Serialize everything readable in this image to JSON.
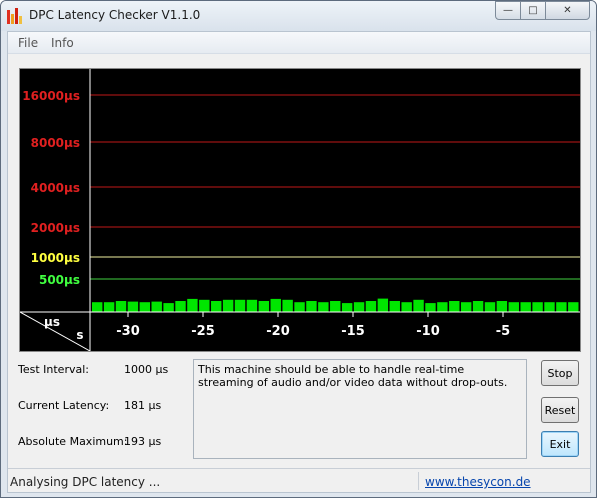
{
  "window": {
    "title": "DPC Latency Checker V1.1.0",
    "controls": {
      "minimize": "—",
      "maximize": "□",
      "close": "✕"
    }
  },
  "menu": {
    "items": [
      "File",
      "Info"
    ]
  },
  "chart_data": {
    "type": "bar",
    "y_labels": [
      "16000µs",
      "8000µs",
      "4000µs",
      "2000µs",
      "1000µs",
      "500µs"
    ],
    "y_label_colors": [
      "#e02020",
      "#e02020",
      "#e02020",
      "#e02020",
      "#ffff40",
      "#40ff40"
    ],
    "ylabel": "µs",
    "xlabel": "s",
    "x_ticks": [
      "-30",
      "-25",
      "-20",
      "-15",
      "-10",
      "-5"
    ],
    "bar_color": "#00e600",
    "values_us": [
      181,
      181,
      185,
      183,
      181,
      183,
      178,
      185,
      192,
      189,
      185,
      189,
      189,
      189,
      185,
      192,
      189,
      181,
      185,
      181,
      185,
      178,
      181,
      185,
      193,
      185,
      181,
      189,
      178,
      181,
      185,
      181,
      185,
      181,
      185,
      181,
      181,
      181,
      181,
      181,
      181
    ]
  },
  "stats": {
    "test_interval_label": "Test Interval:",
    "test_interval_value": "1000 µs",
    "current_latency_label": "Current Latency:",
    "current_latency_value": "181 µs",
    "absolute_max_label": "Absolute Maximum:",
    "absolute_max_value": "193 µs"
  },
  "message": "This machine should be able to handle real-time streaming of audio and/or video data without drop-outs.",
  "buttons": {
    "stop": "Stop",
    "reset": "Reset",
    "exit": "Exit"
  },
  "status": {
    "text": "Analysing DPC latency ...",
    "link": "www.thesycon.de"
  }
}
